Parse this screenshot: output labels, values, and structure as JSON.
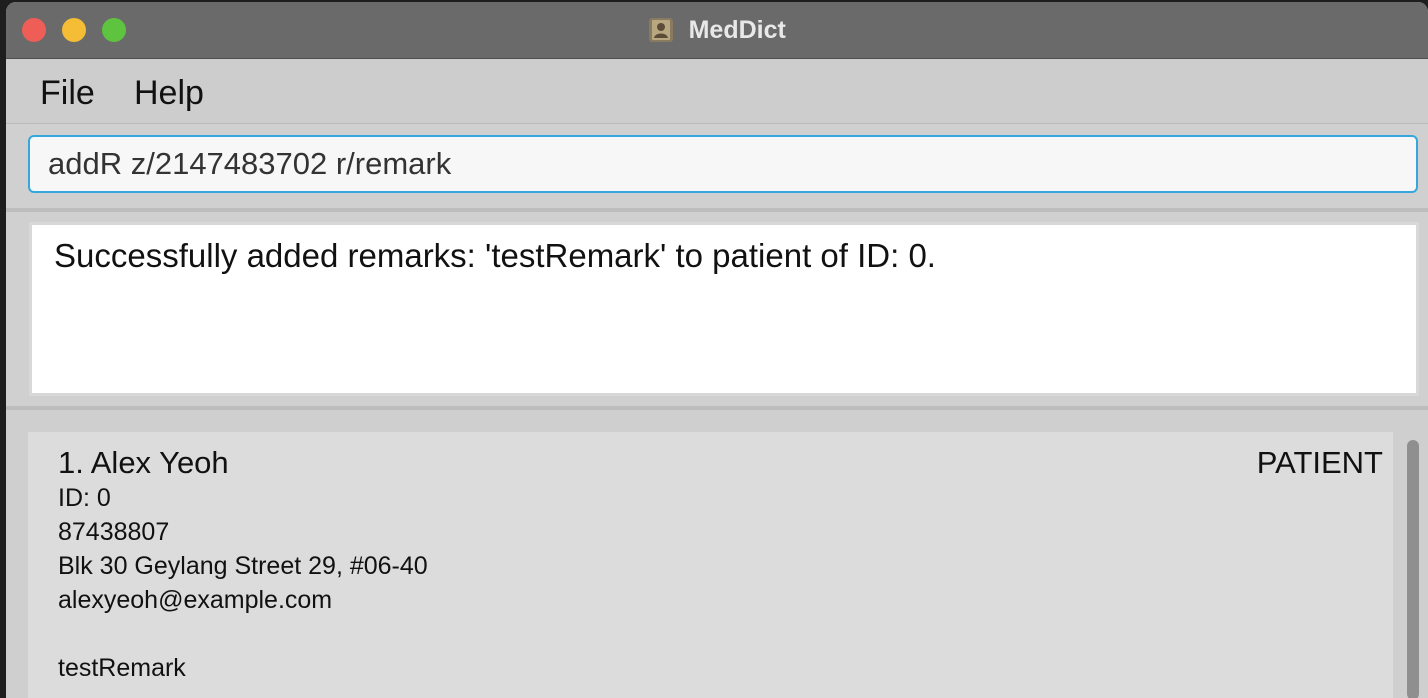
{
  "window": {
    "title": "MedDict",
    "app_icon": "contact-book-icon"
  },
  "menu": {
    "items": [
      {
        "label": "File"
      },
      {
        "label": "Help"
      }
    ]
  },
  "command": {
    "value": "addR z/2147483702 r/remark"
  },
  "result": {
    "message": "Successfully added remarks: 'testRemark' to patient of ID: 0."
  },
  "patients": [
    {
      "index_name": "1. Alex Yeoh",
      "role": "PATIENT",
      "id": "ID: 0",
      "phone": "87438807",
      "address": "Blk 30 Geylang Street 29, #06-40",
      "email": "alexyeoh@example.com",
      "remark": "testRemark"
    }
  ],
  "colors": {
    "accent": "#35a7dc",
    "titlebar": "#6a6a6a",
    "close": "#ee5e56",
    "minimize": "#f4bd35",
    "maximize": "#5ec440"
  }
}
